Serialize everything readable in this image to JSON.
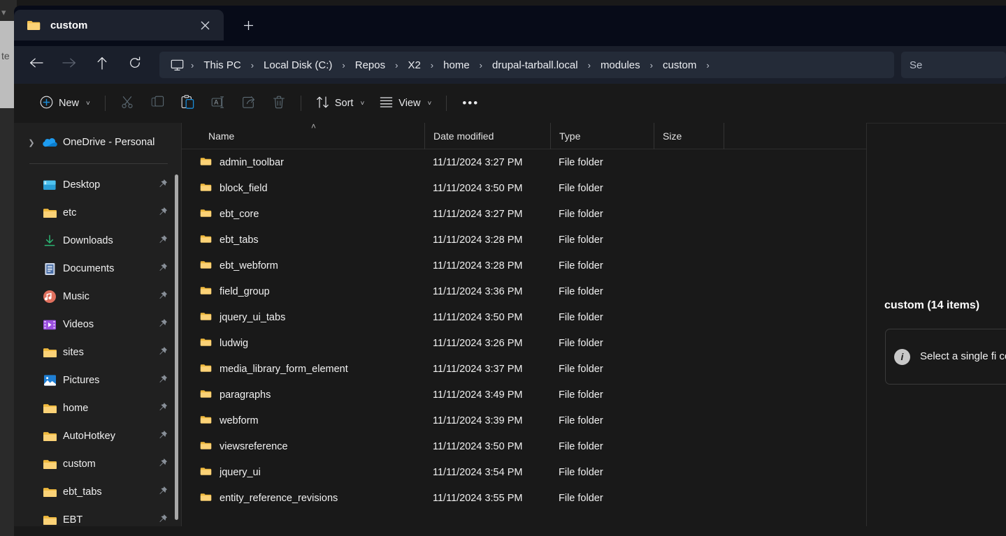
{
  "background_window": {
    "caret_icon": "chevron-down-icon",
    "partial_text": "te"
  },
  "titlebar": {
    "tab": {
      "icon": "folder-icon",
      "label": "custom",
      "close_icon": "close-icon"
    },
    "new_tab_icon": "plus-icon",
    "new_tab_label": "+"
  },
  "navbar": {
    "back_icon": "arrow-left-icon",
    "forward_icon": "arrow-right-icon",
    "up_icon": "arrow-up-icon",
    "refresh_icon": "refresh-icon",
    "breadcrumb": {
      "root_icon": "this-pc-monitor-icon",
      "separator": "›",
      "items": [
        "This PC",
        "Local Disk (C:)",
        "Repos",
        "X2",
        "home",
        "drupal-tarball.local",
        "modules",
        "custom"
      ]
    },
    "search": {
      "icon": "search-icon",
      "placeholder": "Se"
    }
  },
  "commandbar": {
    "new_button": {
      "icon": "plus-circle-icon",
      "label": "New",
      "chevron": "˅"
    },
    "cut": {
      "icon": "scissors-icon",
      "enabled": false
    },
    "copy": {
      "icon": "copy-icon",
      "enabled": false
    },
    "paste": {
      "icon": "paste-icon",
      "enabled": true
    },
    "rename": {
      "icon": "rename-icon",
      "enabled": false
    },
    "share": {
      "icon": "share-icon",
      "enabled": false
    },
    "delete": {
      "icon": "trash-icon",
      "enabled": false
    },
    "sort": {
      "icon": "sort-icon",
      "label": "Sort",
      "chevron": "˅"
    },
    "view": {
      "icon": "view-list-icon",
      "label": "View",
      "chevron": "˅"
    },
    "more": {
      "icon": "ellipsis-icon",
      "label": "•••"
    }
  },
  "navpane": {
    "onedrive": {
      "expand_icon": "chevron-right-icon",
      "icon": "onedrive-cloud-icon",
      "label": "OneDrive - Personal"
    },
    "items": [
      {
        "icon": "desktop-icon",
        "label": "Desktop",
        "pinned": true
      },
      {
        "icon": "folder-icon",
        "label": "etc",
        "pinned": true
      },
      {
        "icon": "downloads-icon",
        "label": "Downloads",
        "pinned": true
      },
      {
        "icon": "documents-icon",
        "label": "Documents",
        "pinned": true
      },
      {
        "icon": "music-icon",
        "label": "Music",
        "pinned": true
      },
      {
        "icon": "videos-icon",
        "label": "Videos",
        "pinned": true
      },
      {
        "icon": "folder-icon",
        "label": "sites",
        "pinned": true
      },
      {
        "icon": "pictures-icon",
        "label": "Pictures",
        "pinned": true
      },
      {
        "icon": "folder-icon",
        "label": "home",
        "pinned": true
      },
      {
        "icon": "folder-icon",
        "label": "AutoHotkey",
        "pinned": true
      },
      {
        "icon": "folder-icon",
        "label": "custom",
        "pinned": true
      },
      {
        "icon": "folder-icon",
        "label": "ebt_tabs",
        "pinned": true
      },
      {
        "icon": "folder-icon",
        "label": "EBT",
        "pinned": true
      }
    ]
  },
  "filelist": {
    "columns": {
      "name": "Name",
      "date_modified": "Date modified",
      "type": "Type",
      "size": "Size"
    },
    "sort_indicator": "˄",
    "rows": [
      {
        "icon": "folder-icon",
        "name": "admin_toolbar",
        "date": "11/11/2024 3:27 PM",
        "type": "File folder",
        "size": ""
      },
      {
        "icon": "folder-icon",
        "name": "block_field",
        "date": "11/11/2024 3:50 PM",
        "type": "File folder",
        "size": ""
      },
      {
        "icon": "folder-icon",
        "name": "ebt_core",
        "date": "11/11/2024 3:27 PM",
        "type": "File folder",
        "size": ""
      },
      {
        "icon": "folder-icon",
        "name": "ebt_tabs",
        "date": "11/11/2024 3:28 PM",
        "type": "File folder",
        "size": ""
      },
      {
        "icon": "folder-icon",
        "name": "ebt_webform",
        "date": "11/11/2024 3:28 PM",
        "type": "File folder",
        "size": ""
      },
      {
        "icon": "folder-icon",
        "name": "field_group",
        "date": "11/11/2024 3:36 PM",
        "type": "File folder",
        "size": ""
      },
      {
        "icon": "folder-icon",
        "name": "jquery_ui_tabs",
        "date": "11/11/2024 3:50 PM",
        "type": "File folder",
        "size": ""
      },
      {
        "icon": "folder-icon",
        "name": "ludwig",
        "date": "11/11/2024 3:26 PM",
        "type": "File folder",
        "size": ""
      },
      {
        "icon": "folder-icon",
        "name": "media_library_form_element",
        "date": "11/11/2024 3:37 PM",
        "type": "File folder",
        "size": ""
      },
      {
        "icon": "folder-icon",
        "name": "paragraphs",
        "date": "11/11/2024 3:49 PM",
        "type": "File folder",
        "size": ""
      },
      {
        "icon": "folder-icon",
        "name": "webform",
        "date": "11/11/2024 3:39 PM",
        "type": "File folder",
        "size": ""
      },
      {
        "icon": "folder-icon",
        "name": "viewsreference",
        "date": "11/11/2024 3:50 PM",
        "type": "File folder",
        "size": ""
      },
      {
        "icon": "folder-icon",
        "name": "jquery_ui",
        "date": "11/11/2024 3:54 PM",
        "type": "File folder",
        "size": ""
      },
      {
        "icon": "folder-icon",
        "name": "entity_reference_revisions",
        "date": "11/11/2024 3:55 PM",
        "type": "File folder",
        "size": ""
      }
    ]
  },
  "detailspane": {
    "title": "custom (14 items)",
    "info_icon": "info-icon",
    "message": "Select a single fi content."
  },
  "colors": {
    "accent": "#1a8cd8",
    "folder": "#fbc85a",
    "window_bg": "#191919",
    "titlebar_bg": "#070b18",
    "navbar_bg": "#1a1f2b",
    "navpane_bg": "#202020"
  }
}
